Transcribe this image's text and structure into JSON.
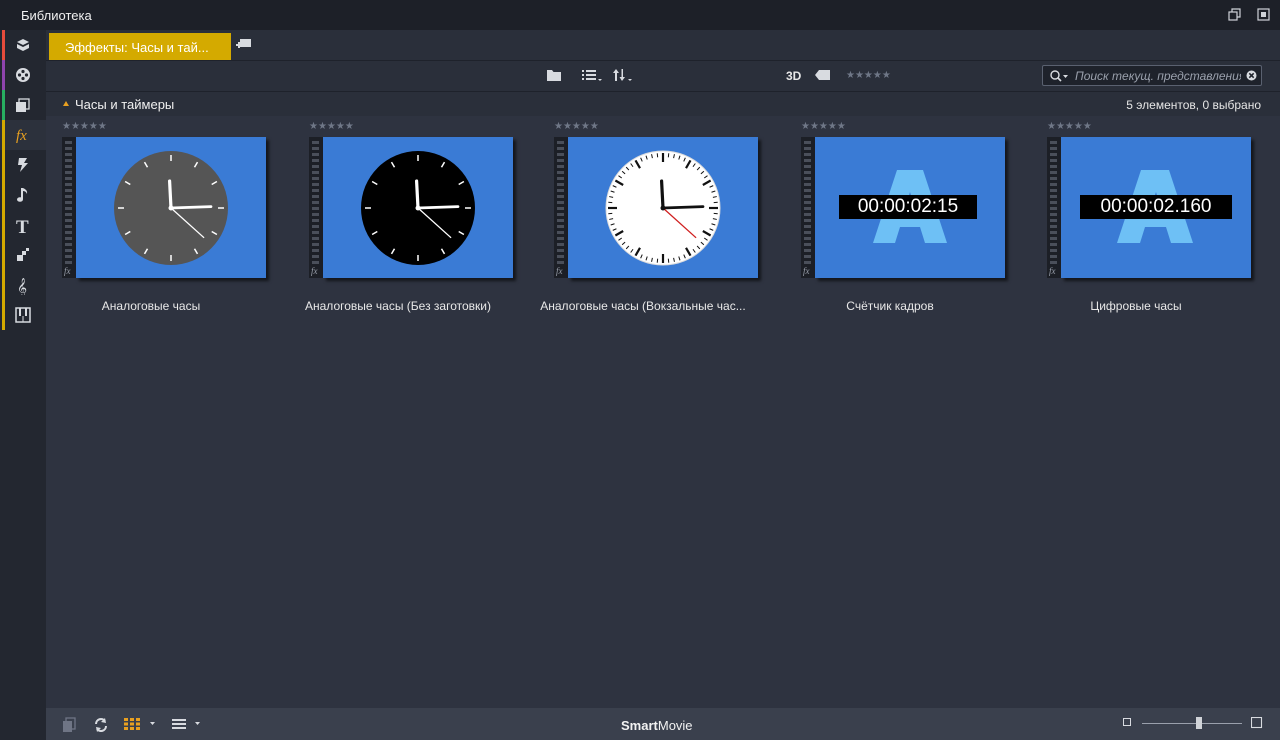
{
  "window": {
    "title": "Библиотека"
  },
  "tabs": {
    "active_label": "Эффекты: Часы и тай..."
  },
  "toolbar": {
    "label_3d": "3D",
    "rating_stars": "★★★★★",
    "search_placeholder": "Поиск текущ. представления"
  },
  "group": {
    "title": "Часы и таймеры",
    "count": "5 элементов, 0 выбрано"
  },
  "items": [
    {
      "label": "Аналоговые часы",
      "stars": "★★★★★",
      "face": "#555555"
    },
    {
      "label": "Аналоговые часы (Без заготовки)",
      "stars": "★★★★★",
      "face": "#000000"
    },
    {
      "label": "Аналоговые часы (Вокзальные час...",
      "stars": "★★★★★",
      "face": "#ffffff"
    },
    {
      "label": "Счётчик кадров",
      "stars": "★★★★★",
      "timecode": "00:00:02:15"
    },
    {
      "label": "Цифровые часы",
      "stars": "★★★★★",
      "timecode": "00:00:02.160"
    }
  ],
  "bottombar": {
    "brand_bold": "Smart",
    "brand_rest": "Movie"
  },
  "colors": {
    "accent_tab": "#d4aa00",
    "thumb_bg": "#3a7bd5",
    "letter_a": "#6ec0f5",
    "sidebar_bars": [
      "#e74c3c",
      "#8e44ad",
      "#27ae60",
      "#d4aa00"
    ]
  },
  "icons": {
    "sidebar": [
      "box-icon",
      "film-reel-icon",
      "stacked-media-icon",
      "fx-icon",
      "lightning-icon",
      "music-note-icon",
      "text-t-icon",
      "montage-icon",
      "treble-clef-icon",
      "piano-icon"
    ]
  }
}
